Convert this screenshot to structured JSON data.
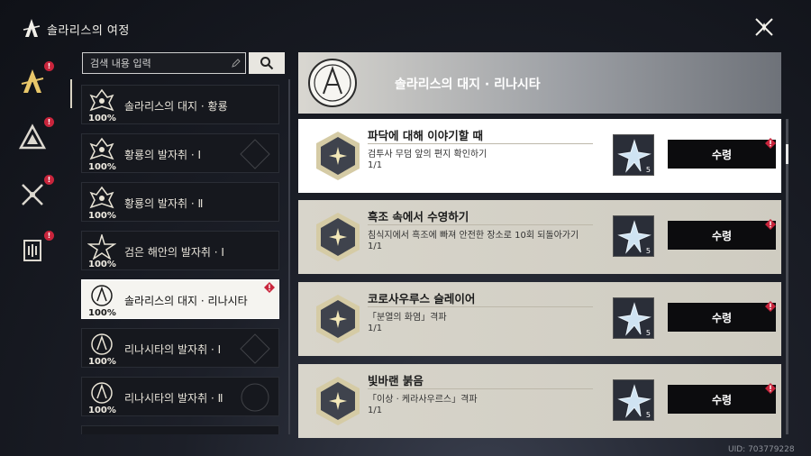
{
  "app": {
    "title": "솔라리스의 여정",
    "uid": "UID: 703779228"
  },
  "colors": {
    "badge_red": "#c9253c",
    "active_item_bg": "#f5f4f0",
    "list_item_bg": "#16181e",
    "claim_button_bg": "#0c0c0e",
    "mission_bg": "#d8d5cb",
    "gold_accent": "#e9c76a"
  },
  "sidebar": {
    "items": [
      {
        "icon": "journey-tacet-icon",
        "badge": "!"
      },
      {
        "icon": "mountain-icon",
        "badge": "!"
      },
      {
        "icon": "crossed-swords-icon",
        "badge": "!"
      },
      {
        "icon": "book-icon",
        "badge": "!"
      }
    ]
  },
  "search": {
    "placeholder": "검색 내용 입력"
  },
  "chapters": [
    {
      "label": "솔라리스의 대지 · 황룡",
      "progress": "100%"
    },
    {
      "label": "황룡의 발자취 · Ⅰ",
      "progress": "100%"
    },
    {
      "label": "황룡의 발자취 · Ⅱ",
      "progress": "100%"
    },
    {
      "label": "검은 해안의 발자취 · Ⅰ",
      "progress": "100%"
    },
    {
      "label": "솔라리스의 대지 · 리나시타",
      "progress": "100%"
    },
    {
      "label": "리나시타의 발자취 · Ⅰ",
      "progress": "100%"
    },
    {
      "label": "리나시타의 발자취 · Ⅱ",
      "progress": "100%"
    }
  ],
  "header": {
    "title": "솔라리스의 대지 · 리나시타"
  },
  "missions": [
    {
      "title": "파닥에 대해 이야기할 때",
      "desc": "검투사 무덤 앞의 편지 확인하기",
      "progress": "1/1",
      "reward_count": "5",
      "claim_label": "수령"
    },
    {
      "title": "흑조 속에서 수영하기",
      "desc": "침식지에서 흑조에 빠져 안전한 장소로 10회 되돌아가기",
      "progress": "1/1",
      "reward_count": "5",
      "claim_label": "수령"
    },
    {
      "title": "코로사우루스 슬레이어",
      "desc": "「분열의 화염」격파",
      "progress": "1/1",
      "reward_count": "5",
      "claim_label": "수령"
    },
    {
      "title": "빛바랜 붉음",
      "desc": "「이상 · 케라사우르스」격파",
      "progress": "1/1",
      "reward_count": "5",
      "claim_label": "수령"
    }
  ]
}
